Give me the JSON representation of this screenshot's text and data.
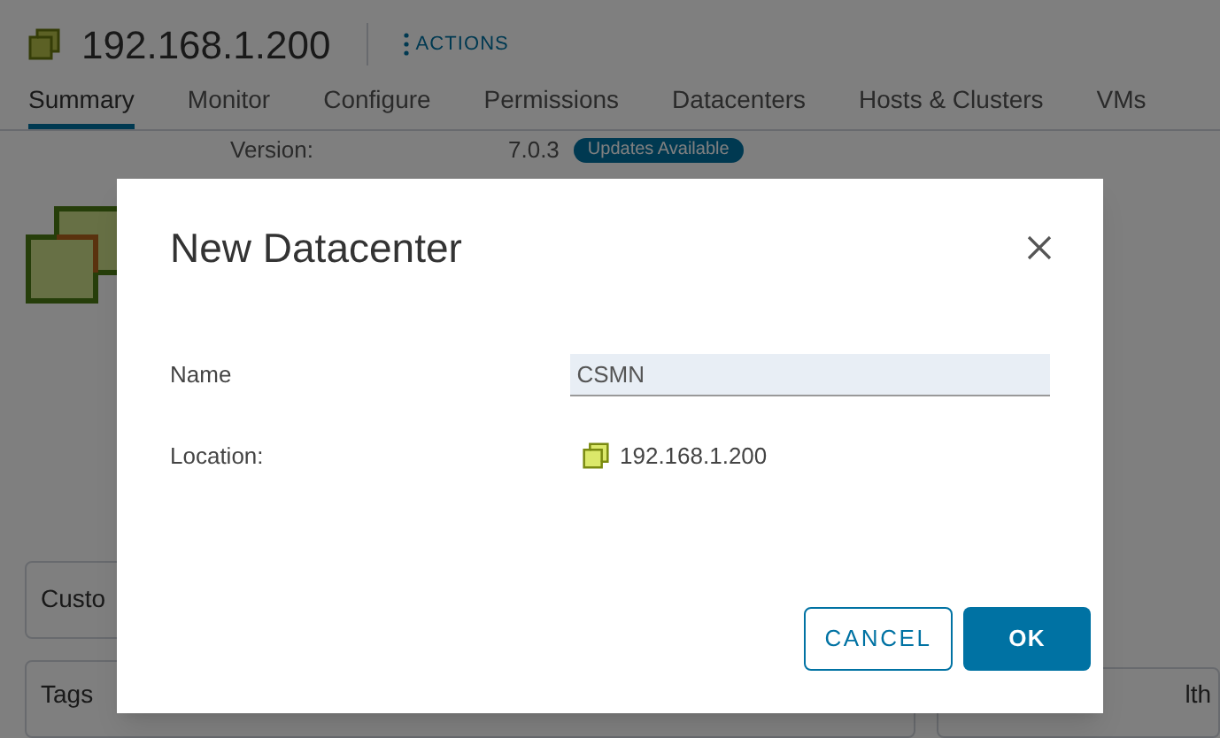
{
  "header": {
    "title": "192.168.1.200",
    "actions": "ACTIONS"
  },
  "tabs": [
    {
      "label": "Summary",
      "selected": true
    },
    {
      "label": "Monitor",
      "selected": false
    },
    {
      "label": "Configure",
      "selected": false
    },
    {
      "label": "Permissions",
      "selected": false
    },
    {
      "label": "Datacenters",
      "selected": false
    },
    {
      "label": "Hosts & Clusters",
      "selected": false
    },
    {
      "label": "VMs",
      "selected": false
    }
  ],
  "summary": {
    "version_label": "Version:",
    "version": "7.0.3",
    "badge": "Updates Available"
  },
  "cards": [
    "Custo",
    "Tags"
  ],
  "right_card": "lth",
  "dialog": {
    "title": "New Datacenter",
    "name_label": "Name",
    "name_value": "CSMN",
    "location_label": "Location:",
    "location_value": "192.168.1.200",
    "buttons": [
      {
        "label": "CANCEL",
        "kind": "outline"
      },
      {
        "label": "OK",
        "kind": "primary"
      }
    ]
  }
}
